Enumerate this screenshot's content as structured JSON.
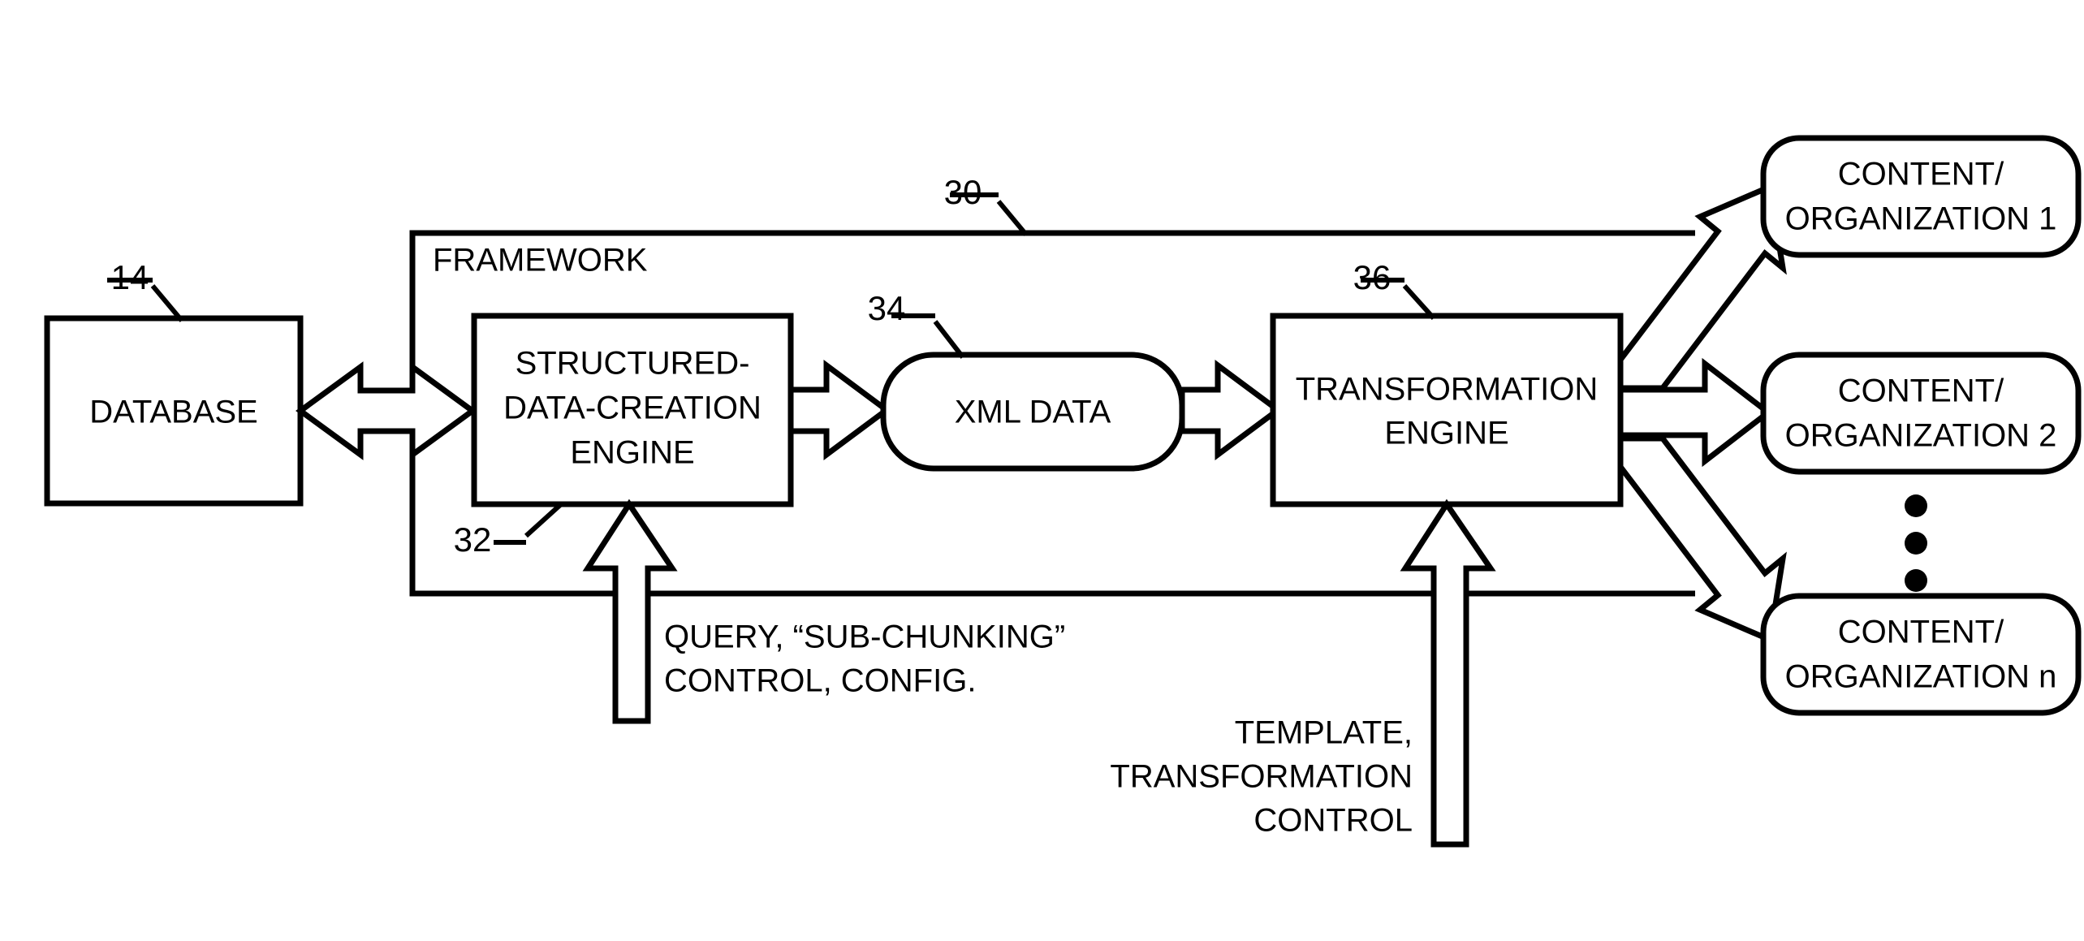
{
  "figure": {
    "title": "Framework data transformation block diagram",
    "background_color": "#ffffff",
    "line_color": "#000000"
  },
  "framework": {
    "label": "FRAMEWORK",
    "ref": "30"
  },
  "blocks": {
    "database": {
      "label": "DATABASE",
      "ref": "14",
      "shape": "rectangle"
    },
    "structured_data_creation_engine": {
      "line1": "STRUCTURED-",
      "line2": "DATA-CREATION",
      "line3": "ENGINE",
      "ref": "32",
      "shape": "rectangle"
    },
    "xml_data": {
      "label": "XML DATA",
      "ref": "34",
      "shape": "rounded-rectangle"
    },
    "transformation_engine": {
      "line1": "TRANSFORMATION",
      "line2": "ENGINE",
      "ref": "36",
      "shape": "rectangle"
    }
  },
  "outputs": {
    "ellipsis_symbol": "vertical-ellipsis",
    "items": [
      {
        "line1": "CONTENT/",
        "line2": "ORGANIZATION 1",
        "shape": "rounded-rectangle"
      },
      {
        "line1": "CONTENT/",
        "line2": "ORGANIZATION 2",
        "shape": "rounded-rectangle"
      },
      {
        "line1": "CONTENT/",
        "line2": "ORGANIZATION n",
        "shape": "rounded-rectangle"
      }
    ]
  },
  "control_inputs": {
    "query_control": {
      "line1": "QUERY, “SUB-CHUNKING”",
      "line2": "CONTROL, CONFIG."
    },
    "template_control": {
      "line1": "TEMPLATE,",
      "line2": "TRANSFORMATION",
      "line3": "CONTROL"
    }
  },
  "connectors": {
    "database_to_engine": "double-headed-block-arrow",
    "engine_to_xml": "right-block-arrow",
    "xml_to_transformation": "right-block-arrow",
    "transformation_to_output1": "diagonal-up-block-arrow",
    "transformation_to_output2": "right-block-arrow",
    "transformation_to_outputn": "diagonal-down-block-arrow",
    "query_into_engine": "up-block-arrow",
    "template_into_transformation": "up-block-arrow"
  }
}
